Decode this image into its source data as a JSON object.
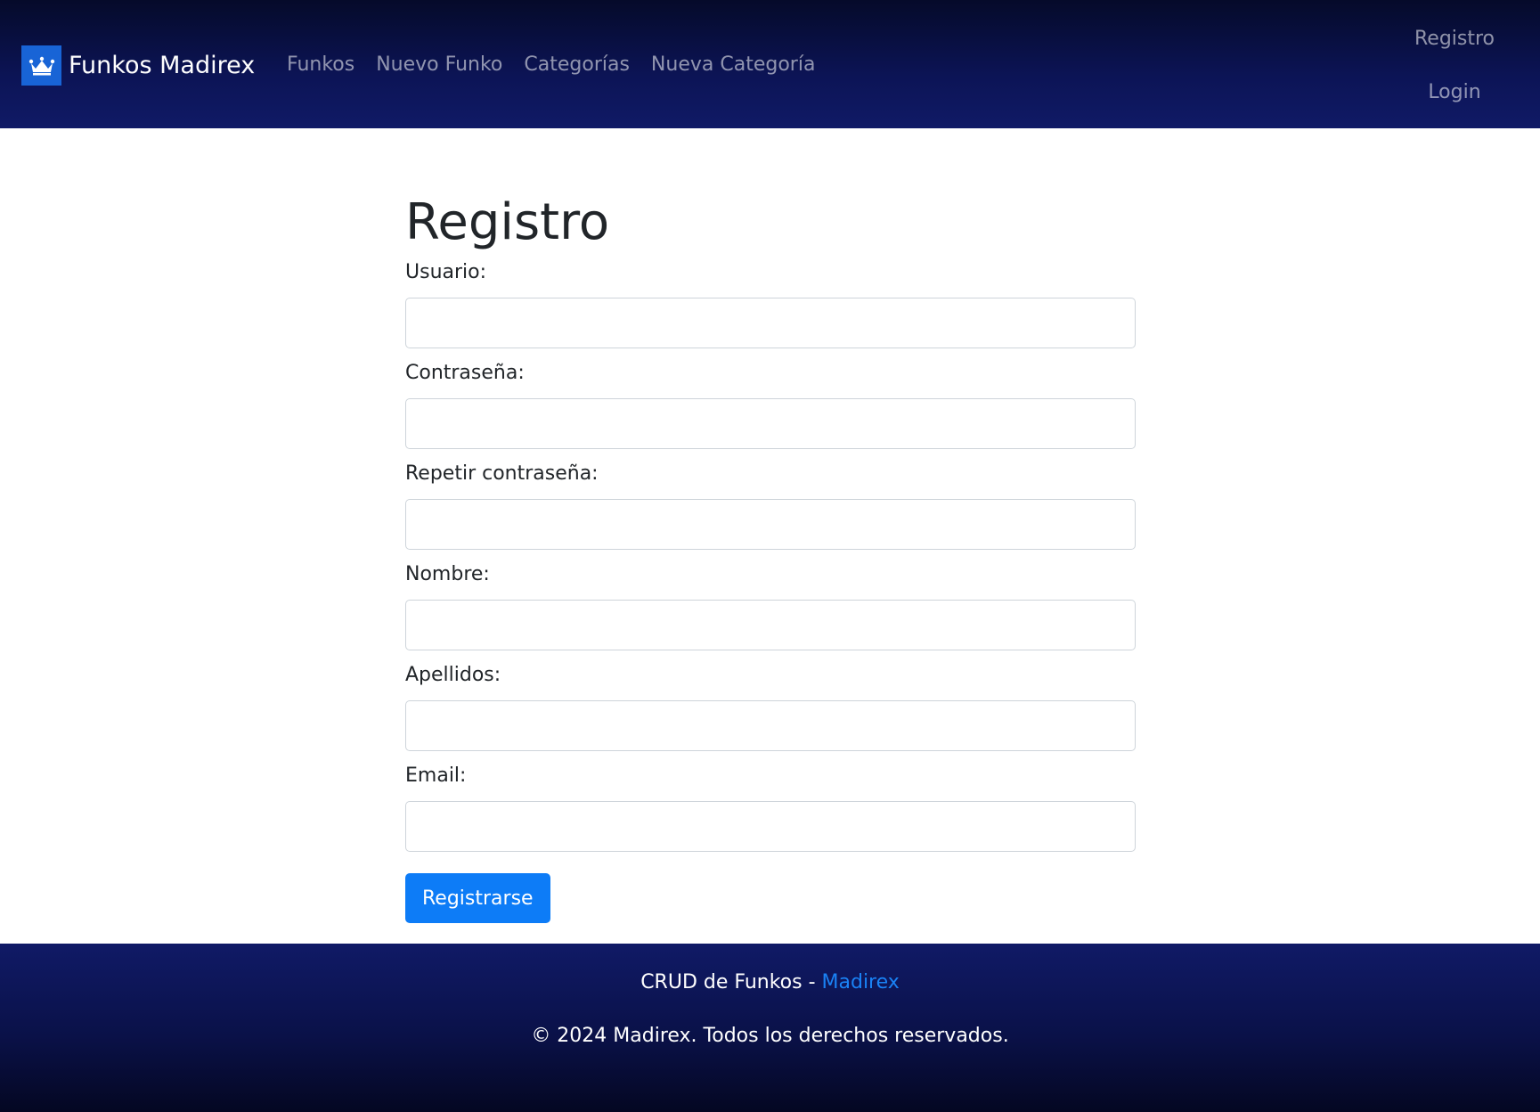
{
  "navbar": {
    "brand": "Funkos Madirex",
    "brand_icon": "crown-icon",
    "links": [
      "Funkos",
      "Nuevo Funko",
      "Categorías",
      "Nueva Categoría"
    ],
    "right_links": [
      "Registro",
      "Login"
    ]
  },
  "form": {
    "title": "Registro",
    "fields": [
      {
        "label": "Usuario:",
        "value": ""
      },
      {
        "label": "Contraseña:",
        "value": ""
      },
      {
        "label": "Repetir contraseña:",
        "value": ""
      },
      {
        "label": "Nombre:",
        "value": ""
      },
      {
        "label": "Apellidos:",
        "value": ""
      },
      {
        "label": "Email:",
        "value": ""
      }
    ],
    "submit_label": "Registrarse"
  },
  "footer": {
    "text": "CRUD de Funkos - ",
    "link": "Madirex",
    "copyright": "© 2024 Madirex. Todos los derechos reservados."
  },
  "colors": {
    "navbar": "#0c1456",
    "primary": "#0d7cf7",
    "link": "#1a82f5"
  }
}
